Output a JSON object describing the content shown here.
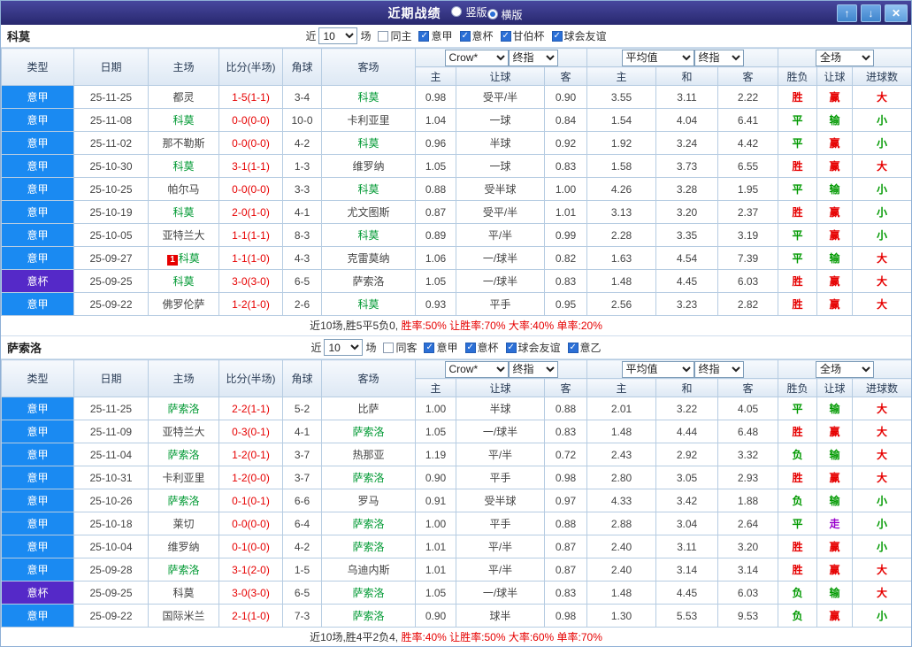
{
  "header": {
    "title": "近期战绩",
    "layout_options": [
      {
        "label": "竖版",
        "selected": false
      },
      {
        "label": "横版",
        "selected": true
      }
    ],
    "buttons": {
      "up": "↑",
      "down": "↓",
      "close": "✕"
    }
  },
  "table_header": {
    "static_cols": [
      "类型",
      "日期",
      "主场",
      "比分(半场)",
      "角球",
      "客场"
    ],
    "sub_cols": [
      "主",
      "让球",
      "客",
      "主",
      "和",
      "客",
      "胜负",
      "让球",
      "进球数"
    ]
  },
  "colors": {
    "league": {
      "意甲": "#1a8af2",
      "意杯": "#5529c8"
    },
    "result": {
      "胜": "#e60000",
      "平": "#009900",
      "负": "#009900",
      "赢": "#e60000",
      "输": "#009900",
      "走": "#9900cc",
      "大": "#e60000",
      "小": "#009900"
    },
    "focus_team": "#009933",
    "score": "#e60000"
  },
  "sections": [
    {
      "team": "科莫",
      "filter": {
        "near_label": "近",
        "count": "10",
        "games_label": "场",
        "checkboxes": [
          {
            "label": "同主",
            "checked": false
          },
          {
            "label": "意甲",
            "checked": true
          },
          {
            "label": "意杯",
            "checked": true
          },
          {
            "label": "甘伯杯",
            "checked": true
          },
          {
            "label": "球会友谊",
            "checked": true
          }
        ]
      },
      "dropdowns": {
        "asia_source": "Crow*",
        "asia_final": "终指",
        "euro_source": "平均值",
        "euro_final": "终指",
        "scope": "全场"
      },
      "rows": [
        {
          "league": "意甲",
          "date": "25-11-25",
          "home": "都灵",
          "home_focus": false,
          "home_badge": "",
          "score": "1-5(1-1)",
          "corners": "3-4",
          "away": "科莫",
          "away_focus": true,
          "ah_home": "0.98",
          "ah_line": "受平/半",
          "ah_away": "0.90",
          "eu_home": "3.55",
          "eu_draw": "3.11",
          "eu_away": "2.22",
          "res": "胜",
          "ah_res": "赢",
          "ou_res": "大"
        },
        {
          "league": "意甲",
          "date": "25-11-08",
          "home": "科莫",
          "home_focus": true,
          "home_badge": "",
          "score": "0-0(0-0)",
          "corners": "10-0",
          "away": "卡利亚里",
          "away_focus": false,
          "ah_home": "1.04",
          "ah_line": "一球",
          "ah_away": "0.84",
          "eu_home": "1.54",
          "eu_draw": "4.04",
          "eu_away": "6.41",
          "res": "平",
          "ah_res": "输",
          "ou_res": "小"
        },
        {
          "league": "意甲",
          "date": "25-11-02",
          "home": "那不勒斯",
          "home_focus": false,
          "home_badge": "",
          "score": "0-0(0-0)",
          "corners": "4-2",
          "away": "科莫",
          "away_focus": true,
          "ah_home": "0.96",
          "ah_line": "半球",
          "ah_away": "0.92",
          "eu_home": "1.92",
          "eu_draw": "3.24",
          "eu_away": "4.42",
          "res": "平",
          "ah_res": "赢",
          "ou_res": "小"
        },
        {
          "league": "意甲",
          "date": "25-10-30",
          "home": "科莫",
          "home_focus": true,
          "home_badge": "",
          "score": "3-1(1-1)",
          "corners": "1-3",
          "away": "维罗纳",
          "away_focus": false,
          "ah_home": "1.05",
          "ah_line": "一球",
          "ah_away": "0.83",
          "eu_home": "1.58",
          "eu_draw": "3.73",
          "eu_away": "6.55",
          "res": "胜",
          "ah_res": "赢",
          "ou_res": "大"
        },
        {
          "league": "意甲",
          "date": "25-10-25",
          "home": "帕尔马",
          "home_focus": false,
          "home_badge": "",
          "score": "0-0(0-0)",
          "corners": "3-3",
          "away": "科莫",
          "away_focus": true,
          "ah_home": "0.88",
          "ah_line": "受半球",
          "ah_away": "1.00",
          "eu_home": "4.26",
          "eu_draw": "3.28",
          "eu_away": "1.95",
          "res": "平",
          "ah_res": "输",
          "ou_res": "小"
        },
        {
          "league": "意甲",
          "date": "25-10-19",
          "home": "科莫",
          "home_focus": true,
          "home_badge": "",
          "score": "2-0(1-0)",
          "corners": "4-1",
          "away": "尤文图斯",
          "away_focus": false,
          "ah_home": "0.87",
          "ah_line": "受平/半",
          "ah_away": "1.01",
          "eu_home": "3.13",
          "eu_draw": "3.20",
          "eu_away": "2.37",
          "res": "胜",
          "ah_res": "赢",
          "ou_res": "小"
        },
        {
          "league": "意甲",
          "date": "25-10-05",
          "home": "亚特兰大",
          "home_focus": false,
          "home_badge": "",
          "score": "1-1(1-1)",
          "corners": "8-3",
          "away": "科莫",
          "away_focus": true,
          "ah_home": "0.89",
          "ah_line": "平/半",
          "ah_away": "0.99",
          "eu_home": "2.28",
          "eu_draw": "3.35",
          "eu_away": "3.19",
          "res": "平",
          "ah_res": "赢",
          "ou_res": "小"
        },
        {
          "league": "意甲",
          "date": "25-09-27",
          "home": "科莫",
          "home_focus": true,
          "home_badge": "1",
          "score": "1-1(1-0)",
          "corners": "4-3",
          "away": "克雷莫纳",
          "away_focus": false,
          "ah_home": "1.06",
          "ah_line": "一/球半",
          "ah_away": "0.82",
          "eu_home": "1.63",
          "eu_draw": "4.54",
          "eu_away": "7.39",
          "res": "平",
          "ah_res": "输",
          "ou_res": "大"
        },
        {
          "league": "意杯",
          "date": "25-09-25",
          "home": "科莫",
          "home_focus": true,
          "home_badge": "",
          "score": "3-0(3-0)",
          "corners": "6-5",
          "away": "萨索洛",
          "away_focus": false,
          "ah_home": "1.05",
          "ah_line": "一/球半",
          "ah_away": "0.83",
          "eu_home": "1.48",
          "eu_draw": "4.45",
          "eu_away": "6.03",
          "res": "胜",
          "ah_res": "赢",
          "ou_res": "大"
        },
        {
          "league": "意甲",
          "date": "25-09-22",
          "home": "佛罗伦萨",
          "home_focus": false,
          "home_badge": "",
          "score": "1-2(1-0)",
          "corners": "2-6",
          "away": "科莫",
          "away_focus": true,
          "ah_home": "0.93",
          "ah_line": "平手",
          "ah_away": "0.95",
          "eu_home": "2.56",
          "eu_draw": "3.23",
          "eu_away": "2.82",
          "res": "胜",
          "ah_res": "赢",
          "ou_res": "大"
        }
      ],
      "summary": [
        {
          "text": "近10场,胜5平5负0, ",
          "red": false
        },
        {
          "text": "胜率:50% 让胜率:70% 大率:40% 单率:20%",
          "red": true
        }
      ]
    },
    {
      "team": "萨索洛",
      "filter": {
        "near_label": "近",
        "count": "10",
        "games_label": "场",
        "checkboxes": [
          {
            "label": "同客",
            "checked": false
          },
          {
            "label": "意甲",
            "checked": true
          },
          {
            "label": "意杯",
            "checked": true
          },
          {
            "label": "球会友谊",
            "checked": true
          },
          {
            "label": "意乙",
            "checked": true
          }
        ]
      },
      "dropdowns": {
        "asia_source": "Crow*",
        "asia_final": "终指",
        "euro_source": "平均值",
        "euro_final": "终指",
        "scope": "全场"
      },
      "rows": [
        {
          "league": "意甲",
          "date": "25-11-25",
          "home": "萨索洛",
          "home_focus": true,
          "home_badge": "",
          "score": "2-2(1-1)",
          "corners": "5-2",
          "away": "比萨",
          "away_focus": false,
          "ah_home": "1.00",
          "ah_line": "半球",
          "ah_away": "0.88",
          "eu_home": "2.01",
          "eu_draw": "3.22",
          "eu_away": "4.05",
          "res": "平",
          "ah_res": "输",
          "ou_res": "大"
        },
        {
          "league": "意甲",
          "date": "25-11-09",
          "home": "亚特兰大",
          "home_focus": false,
          "home_badge": "",
          "score": "0-3(0-1)",
          "corners": "4-1",
          "away": "萨索洛",
          "away_focus": true,
          "ah_home": "1.05",
          "ah_line": "一/球半",
          "ah_away": "0.83",
          "eu_home": "1.48",
          "eu_draw": "4.44",
          "eu_away": "6.48",
          "res": "胜",
          "ah_res": "赢",
          "ou_res": "大"
        },
        {
          "league": "意甲",
          "date": "25-11-04",
          "home": "萨索洛",
          "home_focus": true,
          "home_badge": "",
          "score": "1-2(0-1)",
          "corners": "3-7",
          "away": "热那亚",
          "away_focus": false,
          "ah_home": "1.19",
          "ah_line": "平/半",
          "ah_away": "0.72",
          "eu_home": "2.43",
          "eu_draw": "2.92",
          "eu_away": "3.32",
          "res": "负",
          "ah_res": "输",
          "ou_res": "大"
        },
        {
          "league": "意甲",
          "date": "25-10-31",
          "home": "卡利亚里",
          "home_focus": false,
          "home_badge": "",
          "score": "1-2(0-0)",
          "corners": "3-7",
          "away": "萨索洛",
          "away_focus": true,
          "ah_home": "0.90",
          "ah_line": "平手",
          "ah_away": "0.98",
          "eu_home": "2.80",
          "eu_draw": "3.05",
          "eu_away": "2.93",
          "res": "胜",
          "ah_res": "赢",
          "ou_res": "大"
        },
        {
          "league": "意甲",
          "date": "25-10-26",
          "home": "萨索洛",
          "home_focus": true,
          "home_badge": "",
          "score": "0-1(0-1)",
          "corners": "6-6",
          "away": "罗马",
          "away_focus": false,
          "ah_home": "0.91",
          "ah_line": "受半球",
          "ah_away": "0.97",
          "eu_home": "4.33",
          "eu_draw": "3.42",
          "eu_away": "1.88",
          "res": "负",
          "ah_res": "输",
          "ou_res": "小"
        },
        {
          "league": "意甲",
          "date": "25-10-18",
          "home": "莱切",
          "home_focus": false,
          "home_badge": "",
          "score": "0-0(0-0)",
          "corners": "6-4",
          "away": "萨索洛",
          "away_focus": true,
          "ah_home": "1.00",
          "ah_line": "平手",
          "ah_away": "0.88",
          "eu_home": "2.88",
          "eu_draw": "3.04",
          "eu_away": "2.64",
          "res": "平",
          "ah_res": "走",
          "ou_res": "小"
        },
        {
          "league": "意甲",
          "date": "25-10-04",
          "home": "维罗纳",
          "home_focus": false,
          "home_badge": "",
          "score": "0-1(0-0)",
          "corners": "4-2",
          "away": "萨索洛",
          "away_focus": true,
          "ah_home": "1.01",
          "ah_line": "平/半",
          "ah_away": "0.87",
          "eu_home": "2.40",
          "eu_draw": "3.11",
          "eu_away": "3.20",
          "res": "胜",
          "ah_res": "赢",
          "ou_res": "小"
        },
        {
          "league": "意甲",
          "date": "25-09-28",
          "home": "萨索洛",
          "home_focus": true,
          "home_badge": "",
          "score": "3-1(2-0)",
          "corners": "1-5",
          "away": "乌迪内斯",
          "away_focus": false,
          "ah_home": "1.01",
          "ah_line": "平/半",
          "ah_away": "0.87",
          "eu_home": "2.40",
          "eu_draw": "3.14",
          "eu_away": "3.14",
          "res": "胜",
          "ah_res": "赢",
          "ou_res": "大"
        },
        {
          "league": "意杯",
          "date": "25-09-25",
          "home": "科莫",
          "home_focus": false,
          "home_badge": "",
          "score": "3-0(3-0)",
          "corners": "6-5",
          "away": "萨索洛",
          "away_focus": true,
          "ah_home": "1.05",
          "ah_line": "一/球半",
          "ah_away": "0.83",
          "eu_home": "1.48",
          "eu_draw": "4.45",
          "eu_away": "6.03",
          "res": "负",
          "ah_res": "输",
          "ou_res": "大"
        },
        {
          "league": "意甲",
          "date": "25-09-22",
          "home": "国际米兰",
          "home_focus": false,
          "home_badge": "",
          "score": "2-1(1-0)",
          "corners": "7-3",
          "away": "萨索洛",
          "away_focus": true,
          "ah_home": "0.90",
          "ah_line": "球半",
          "ah_away": "0.98",
          "eu_home": "1.30",
          "eu_draw": "5.53",
          "eu_away": "9.53",
          "res": "负",
          "ah_res": "赢",
          "ou_res": "小"
        }
      ],
      "summary": [
        {
          "text": "近10场,胜4平2负4, ",
          "red": false
        },
        {
          "text": "胜率:40% 让胜率:50% 大率:60% 单率:70%",
          "red": true
        }
      ]
    }
  ]
}
